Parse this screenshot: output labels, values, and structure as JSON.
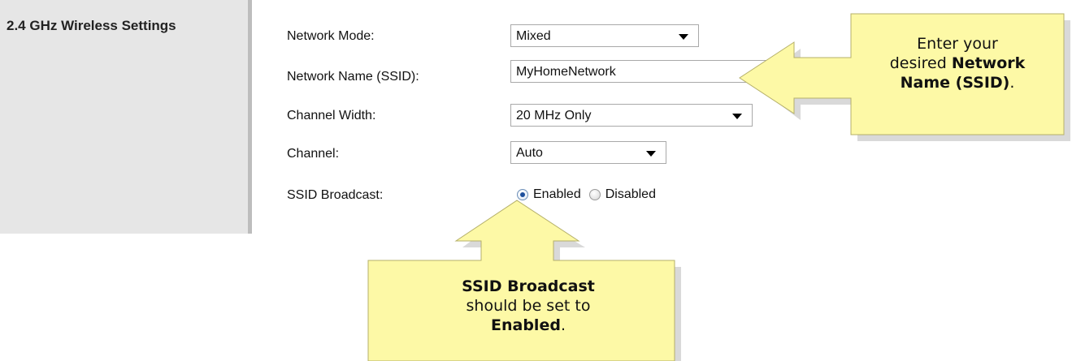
{
  "section": {
    "title": "2.4 GHz Wireless Settings"
  },
  "fields": {
    "network_mode": {
      "label": "Network Mode:",
      "value": "Mixed"
    },
    "ssid": {
      "label": "Network Name (SSID):",
      "value": "MyHomeNetwork"
    },
    "channel_width": {
      "label": "Channel Width:",
      "value": "20 MHz Only"
    },
    "channel": {
      "label": "Channel:",
      "value": "Auto"
    },
    "ssid_broadcast": {
      "label": "SSID Broadcast:",
      "options": [
        "Enabled",
        "Disabled"
      ],
      "selected": "Enabled"
    }
  },
  "callouts": {
    "ssid": {
      "line1": "Enter your",
      "line2_pre": "desired ",
      "line2_bold": "Network",
      "line3_bold": "Name (SSID)",
      "line3_post": "."
    },
    "broadcast": {
      "line1_bold": "SSID Broadcast",
      "line2": "should be set to",
      "line3_bold": "Enabled",
      "line3_post": "."
    }
  },
  "colors": {
    "callout_fill": "#fdf9a6",
    "callout_stroke": "#b5b06a",
    "sidebar_bg": "#e6e6e6",
    "radio_selected": "#1d4f9c"
  }
}
